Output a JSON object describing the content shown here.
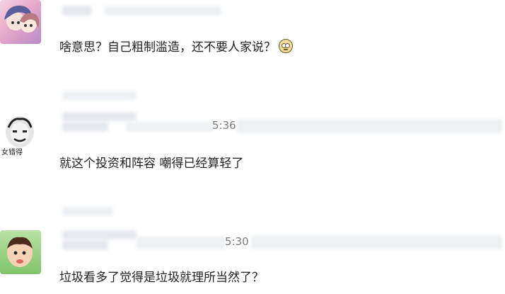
{
  "comments": [
    {
      "text": "啥意思？自己粗制滥造，还不要人家说？",
      "time": "",
      "emoji": "confused-face-emoji"
    },
    {
      "text": "就这个投资和阵容 嘲得已经算轻了",
      "time": "5:36",
      "avatar_caption": "女错得"
    },
    {
      "text": "垃圾看多了觉得是垃圾就理所当然了？",
      "time": "5:30"
    }
  ]
}
